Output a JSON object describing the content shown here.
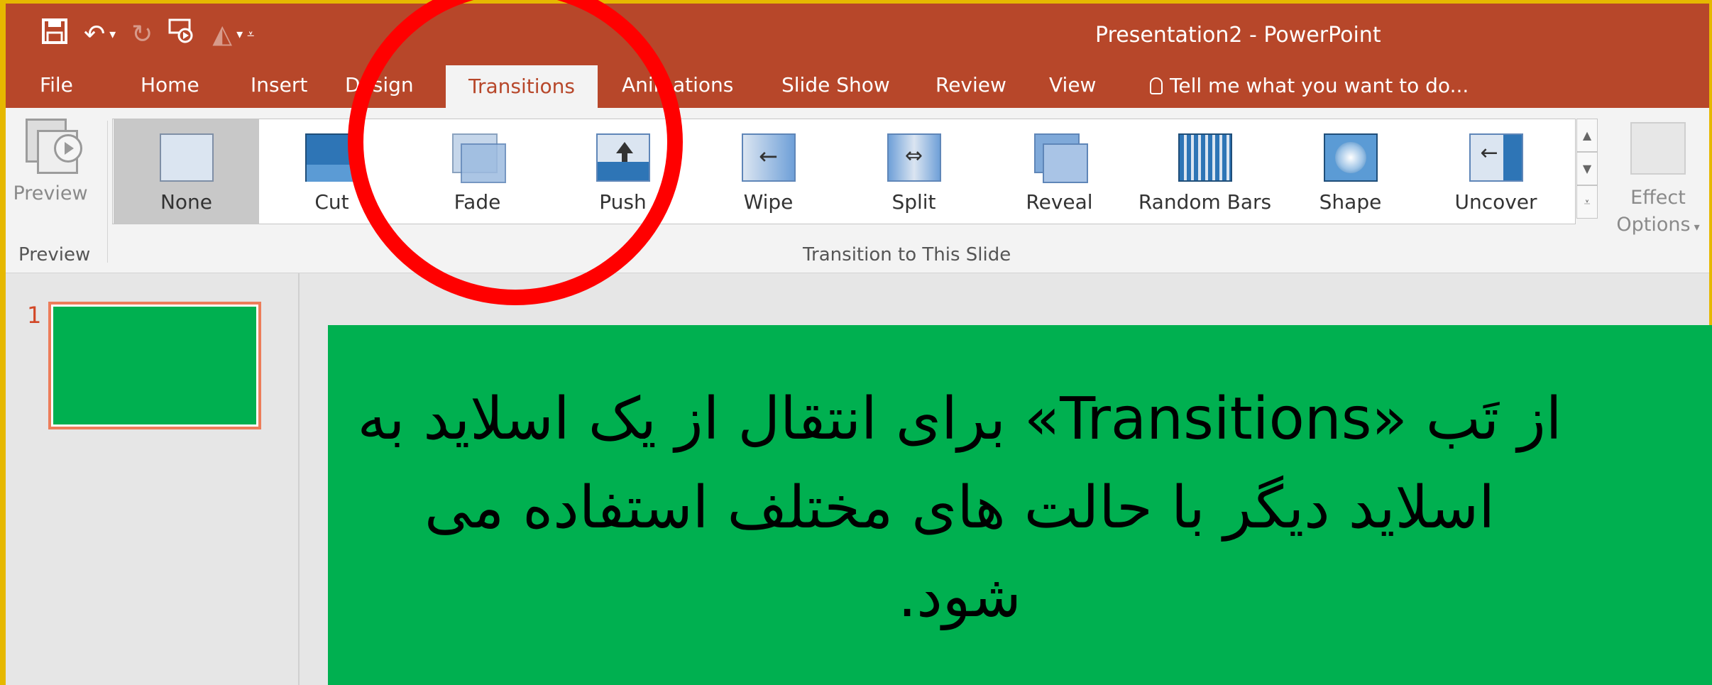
{
  "window": {
    "title": "Presentation2 - PowerPoint"
  },
  "tabs": [
    {
      "label": "File"
    },
    {
      "label": "Home"
    },
    {
      "label": "Insert"
    },
    {
      "label": "Design"
    },
    {
      "label": "Transitions"
    },
    {
      "label": "Animations"
    },
    {
      "label": "Slide Show"
    },
    {
      "label": "Review"
    },
    {
      "label": "View"
    }
  ],
  "tell_me": {
    "label": "Tell me what you want to do..."
  },
  "preview": {
    "button_label": "Preview",
    "group_label": "Preview"
  },
  "transitions": {
    "group_label": "Transition to This Slide",
    "items": [
      {
        "label": "None",
        "selected": true
      },
      {
        "label": "Cut"
      },
      {
        "label": "Fade"
      },
      {
        "label": "Push"
      },
      {
        "label": "Wipe"
      },
      {
        "label": "Split"
      },
      {
        "label": "Reveal"
      },
      {
        "label": "Random Bars"
      },
      {
        "label": "Shape"
      },
      {
        "label": "Uncover"
      }
    ]
  },
  "effect_options": {
    "line1": "Effect",
    "line2": "Options"
  },
  "slides_panel": {
    "slide_number": "1"
  },
  "slide": {
    "text": "از تَب «Transitions» برای انتقال از یک اسلاید به اسلاید دیگر با حالت های مختلف استفاده می شود.",
    "background": "#00b050"
  },
  "colors": {
    "accent": "#b7472a",
    "annotation": "#ff0000"
  }
}
